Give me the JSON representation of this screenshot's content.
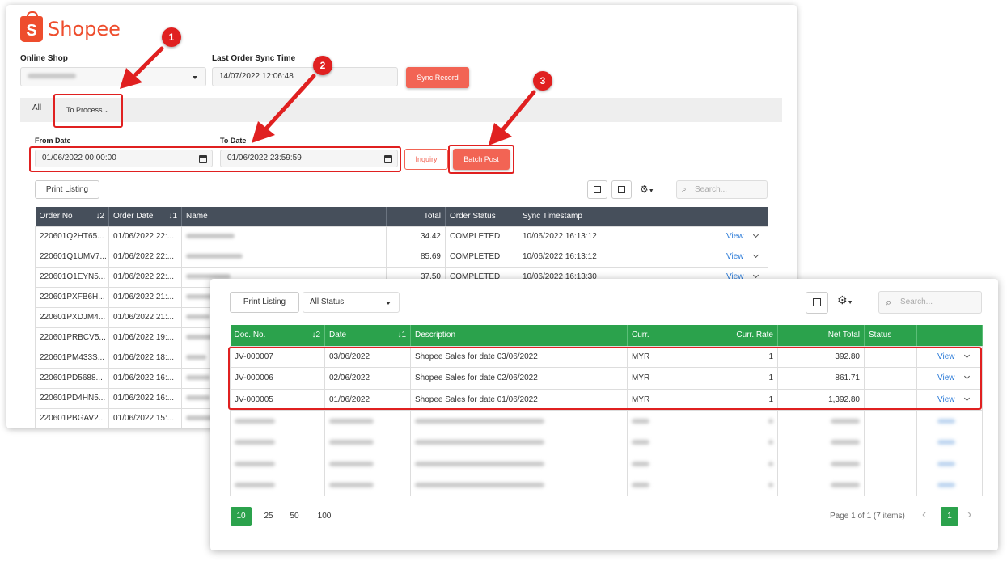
{
  "logo": {
    "text": "Shopee",
    "letter": "S"
  },
  "filters": {
    "online_shop_label": "Online Shop",
    "last_sync_label": "Last Order Sync Time",
    "last_sync_value": "14/07/2022 12:06:48",
    "sync_button": "Sync Record",
    "tabs": {
      "all": "All",
      "to_process": "To Process"
    },
    "from_date_label": "From Date",
    "from_date_value": "01/06/2022 00:00:00",
    "to_date_label": "To Date",
    "to_date_value": "01/06/2022 23:59:59",
    "inquiry_button": "Inquiry",
    "batch_post_button": "Batch Post"
  },
  "orders": {
    "print_button": "Print Listing",
    "search_placeholder": "Search...",
    "columns": [
      "Order No",
      "Order Date",
      "Name",
      "Total",
      "Order Status",
      "Sync Timestamp"
    ],
    "sort_order_no": "↓2",
    "sort_order_date": "↓1",
    "rows": [
      {
        "order_no": "220601Q2HT65...",
        "date": "01/06/2022 22:...",
        "total": "34.42",
        "status": "COMPLETED",
        "sync": "10/06/2022 16:13:12",
        "view": "View"
      },
      {
        "order_no": "220601Q1UMV7...",
        "date": "01/06/2022 22:...",
        "total": "85.69",
        "status": "COMPLETED",
        "sync": "10/06/2022 16:13:12",
        "view": "View"
      },
      {
        "order_no": "220601Q1EYN5...",
        "date": "01/06/2022 22:...",
        "total": "37.50",
        "status": "COMPLETED",
        "sync": "10/06/2022 16:13:30",
        "view": "View"
      },
      {
        "order_no": "220601PXFB6H...",
        "date": "01/06/2022 21:..."
      },
      {
        "order_no": "220601PXDJM4...",
        "date": "01/06/2022 21:..."
      },
      {
        "order_no": "220601PRBCV5...",
        "date": "01/06/2022 19:..."
      },
      {
        "order_no": "220601PM433S...",
        "date": "01/06/2022 18:..."
      },
      {
        "order_no": "220601PD5688...",
        "date": "01/06/2022 16:..."
      },
      {
        "order_no": "220601PD4HN5...",
        "date": "01/06/2022 16:..."
      },
      {
        "order_no": "220601PBGAV2...",
        "date": "01/06/2022 15:..."
      }
    ]
  },
  "markers": [
    "1",
    "2",
    "3"
  ],
  "journal": {
    "print_button": "Print Listing",
    "status_filter": "All Status",
    "search_placeholder": "Search...",
    "columns": [
      "Doc. No.",
      "Date",
      "Description",
      "Curr.",
      "Curr. Rate",
      "Net Total",
      "Status"
    ],
    "sort_doc": "↓2",
    "sort_date": "↓1",
    "rows": [
      {
        "doc": "JV-000007",
        "date": "03/06/2022",
        "desc": "Shopee Sales for date 03/06/2022",
        "curr": "MYR",
        "rate": "1",
        "net": "392.80",
        "view": "View"
      },
      {
        "doc": "JV-000006",
        "date": "02/06/2022",
        "desc": "Shopee Sales for date 02/06/2022",
        "curr": "MYR",
        "rate": "1",
        "net": "861.71",
        "view": "View"
      },
      {
        "doc": "JV-000005",
        "date": "01/06/2022",
        "desc": "Shopee Sales for date 01/06/2022",
        "curr": "MYR",
        "rate": "1",
        "net": "1,392.80",
        "view": "View"
      }
    ],
    "page_sizes": [
      "10",
      "25",
      "50",
      "100"
    ],
    "page_info": "Page 1 of 1 (7 items)",
    "current_page": "1"
  },
  "colors": {
    "brand": "#ee4d2d",
    "button": "#f26454",
    "annotation": "#e02020",
    "header_dark": "#464f5b",
    "header_green": "#2ba24c",
    "link": "#2b7bd8"
  }
}
